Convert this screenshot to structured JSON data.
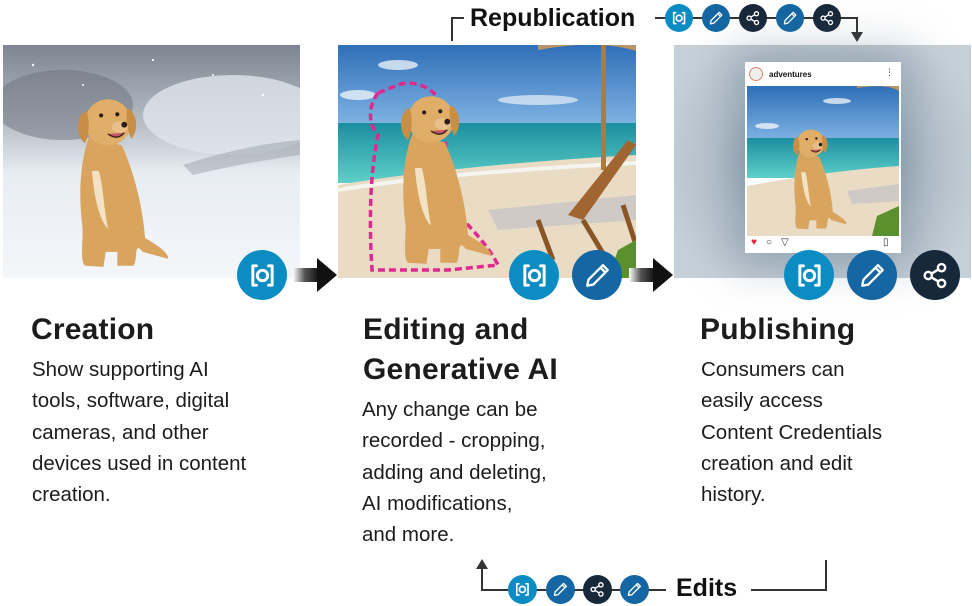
{
  "flows": {
    "republication": {
      "label": "Republication",
      "icons": [
        "camera-icon",
        "pencil-icon",
        "share-icon",
        "pencil-icon",
        "share-icon"
      ]
    },
    "edits": {
      "label": "Edits",
      "icons": [
        "camera-icon",
        "pencil-icon",
        "share-icon",
        "pencil-icon"
      ]
    }
  },
  "colors": {
    "camera": "#0b8dc3",
    "pencil": "#1467a3",
    "share": "#17283a",
    "selection_outline": "#e0288f"
  },
  "stages": [
    {
      "title": "Creation",
      "image": "golden retriever sitting in snow",
      "icons": [
        "camera-icon"
      ],
      "description_lines": [
        "Show supporting AI",
        "tools, software, digital",
        "cameras, and other",
        "devices used in content",
        "creation."
      ]
    },
    {
      "title_lines": [
        "Editing and",
        "Generative AI"
      ],
      "image": "golden retriever composited onto beach with dashed selection outline",
      "icons": [
        "camera-icon",
        "pencil-icon"
      ],
      "description_lines": [
        "Any change can be",
        "recorded - cropping,",
        "adding and deleting,",
        "AI modifications,",
        "and more."
      ]
    },
    {
      "title": "Publishing",
      "image": "social media post of dog on beach",
      "post": {
        "username": "adventures",
        "more": "⋮"
      },
      "icons": [
        "camera-icon",
        "pencil-icon",
        "share-icon"
      ],
      "description_lines": [
        "Consumers can",
        "easily access",
        "Content Credentials",
        "creation and edit",
        "history."
      ]
    }
  ]
}
